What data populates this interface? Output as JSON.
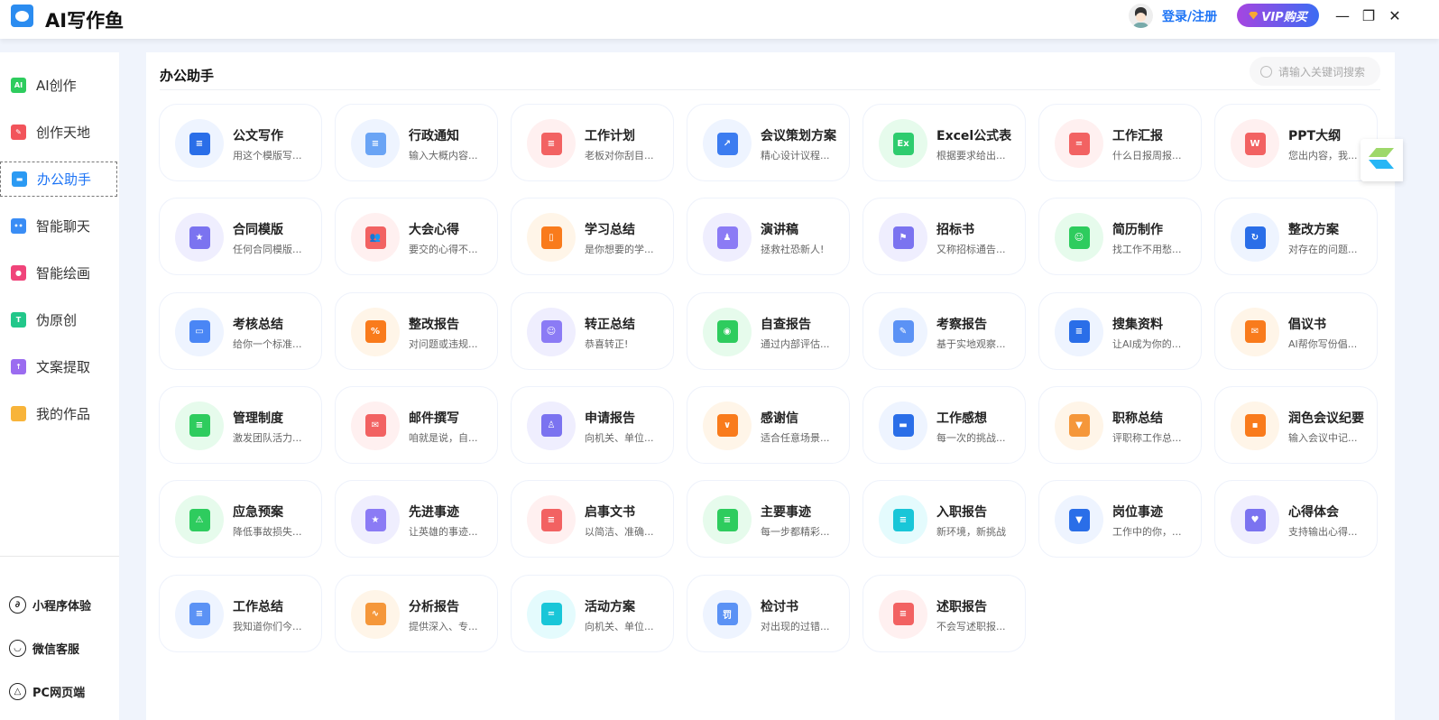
{
  "header": {
    "app_title": "AI写作鱼",
    "login_label": "登录/注册",
    "vip_label": "VIP购买",
    "minimize": "—",
    "maximize": "❐",
    "close": "✕"
  },
  "sidebar": {
    "items": [
      {
        "label": "AI创作",
        "icon": "ai-doc-icon",
        "color": "#2ecc5e",
        "glyph": "AI"
      },
      {
        "label": "创作天地",
        "icon": "pencil-icon",
        "color": "#f2545b",
        "glyph": "✎"
      },
      {
        "label": "办公助手",
        "icon": "briefcase-icon",
        "color": "#2b9af3",
        "glyph": "▬",
        "active": true
      },
      {
        "label": "智能聊天",
        "icon": "chat-icon",
        "color": "#3a8df5",
        "glyph": "••"
      },
      {
        "label": "智能绘画",
        "icon": "palette-icon",
        "color": "#f0447a",
        "glyph": "●"
      },
      {
        "label": "伪原创",
        "icon": "t-doc-icon",
        "color": "#22c78a",
        "glyph": "T"
      },
      {
        "label": "文案提取",
        "icon": "upload-icon",
        "color": "#9b6cf0",
        "glyph": "↑"
      },
      {
        "label": "我的作品",
        "icon": "folder-icon",
        "color": "#f8b43a",
        "glyph": ""
      }
    ],
    "footer": [
      {
        "label": "小程序体验",
        "icon": "mini-program-icon",
        "glyph": "∂"
      },
      {
        "label": "微信客服",
        "icon": "chat-bubble-icon",
        "glyph": "◡"
      },
      {
        "label": "PC网页端",
        "icon": "screen-icon",
        "glyph": "△"
      }
    ]
  },
  "main": {
    "title": "办公助手",
    "search_placeholder": "请输入关键词搜索",
    "cards": [
      {
        "title": "公文写作",
        "desc": "用这个模版写...",
        "color": "#2a6ee8",
        "bg": "#eef4ff",
        "glyph": "≡"
      },
      {
        "title": "行政通知",
        "desc": "输入大概内容...",
        "color": "#6aa4f5",
        "bg": "#eef4ff",
        "glyph": "≡"
      },
      {
        "title": "工作计划",
        "desc": "老板对你刮目...",
        "color": "#f26262",
        "bg": "#fff0f0",
        "glyph": "≡"
      },
      {
        "title": "会议策划方案",
        "desc": "精心设计议程...",
        "color": "#3c7cf0",
        "bg": "#eef4ff",
        "glyph": "↗"
      },
      {
        "title": "Excel公式表",
        "desc": "根据要求给出...",
        "color": "#2ecc6e",
        "bg": "#e6fbec",
        "glyph": "Ex"
      },
      {
        "title": "工作汇报",
        "desc": "什么日报周报...",
        "color": "#f26262",
        "bg": "#fff0f0",
        "glyph": "="
      },
      {
        "title": "PPT大纲",
        "desc": "您出内容，我...",
        "color": "#f26262",
        "bg": "#fff0f0",
        "glyph": "W"
      },
      {
        "title": "合同模版",
        "desc": "任何合同模版...",
        "color": "#7b73f0",
        "bg": "#efeefe",
        "glyph": "★"
      },
      {
        "title": "大会心得",
        "desc": "要交的心得不...",
        "color": "#f26262",
        "bg": "#fff0f0",
        "glyph": "👥"
      },
      {
        "title": "学习总结",
        "desc": "是你想要的学...",
        "color": "#f97b1c",
        "bg": "#fff5e8",
        "glyph": "▯"
      },
      {
        "title": "演讲稿",
        "desc": "拯救社恐新人!",
        "color": "#8b7bf5",
        "bg": "#efeefe",
        "glyph": "♟"
      },
      {
        "title": "招标书",
        "desc": "又称招标通告...",
        "color": "#7b73f0",
        "bg": "#efeefe",
        "glyph": "⚑"
      },
      {
        "title": "简历制作",
        "desc": "找工作不用愁...",
        "color": "#2ecc5e",
        "bg": "#e6fbec",
        "glyph": "☺"
      },
      {
        "title": "整改方案",
        "desc": "对存在的问题...",
        "color": "#2a6ee8",
        "bg": "#eef4ff",
        "glyph": "↻"
      },
      {
        "title": "考核总结",
        "desc": "给你一个标准...",
        "color": "#4a86f5",
        "bg": "#eef4ff",
        "glyph": "▭"
      },
      {
        "title": "整改报告",
        "desc": "对问题或违规...",
        "color": "#f97b1c",
        "bg": "#fff5e8",
        "glyph": "%"
      },
      {
        "title": "转正总结",
        "desc": "恭喜转正!",
        "color": "#8b7bf5",
        "bg": "#efeefe",
        "glyph": "☺"
      },
      {
        "title": "自查报告",
        "desc": "通过内部评估...",
        "color": "#2ecc5e",
        "bg": "#e6fbec",
        "glyph": "◉"
      },
      {
        "title": "考察报告",
        "desc": "基于实地观察...",
        "color": "#5b92f5",
        "bg": "#eef4ff",
        "glyph": "✎"
      },
      {
        "title": "搜集资料",
        "desc": "让AI成为你的...",
        "color": "#2a6ee8",
        "bg": "#eef4ff",
        "glyph": "≡"
      },
      {
        "title": "倡议书",
        "desc": "AI帮你写份倡...",
        "color": "#f97b1c",
        "bg": "#fff5e8",
        "glyph": "✉"
      },
      {
        "title": "管理制度",
        "desc": "激发团队活力...",
        "color": "#2ecc5e",
        "bg": "#e6fbec",
        "glyph": "≡"
      },
      {
        "title": "邮件撰写",
        "desc": "咱就是说，自...",
        "color": "#f26262",
        "bg": "#fff0f0",
        "glyph": "✉"
      },
      {
        "title": "申请报告",
        "desc": "向机关、单位...",
        "color": "#7b73f0",
        "bg": "#efeefe",
        "glyph": "♙"
      },
      {
        "title": "感谢信",
        "desc": "适合任意场景...",
        "color": "#f97b1c",
        "bg": "#fff5e8",
        "glyph": "∨"
      },
      {
        "title": "工作感想",
        "desc": "每一次的挑战...",
        "color": "#2a6ee8",
        "bg": "#eef4ff",
        "glyph": "▬"
      },
      {
        "title": "职称总结",
        "desc": "评职称工作总...",
        "color": "#f5973a",
        "bg": "#fff5e8",
        "glyph": "▼"
      },
      {
        "title": "润色会议纪要",
        "desc": "输入会议中记...",
        "color": "#f97b1c",
        "bg": "#fff5e8",
        "glyph": "▪"
      },
      {
        "title": "应急预案",
        "desc": "降低事故损失...",
        "color": "#2ecc5e",
        "bg": "#e6fbec",
        "glyph": "⚠"
      },
      {
        "title": "先进事迹",
        "desc": "让英雄的事迹...",
        "color": "#8b7bf5",
        "bg": "#efeefe",
        "glyph": "★"
      },
      {
        "title": "启事文书",
        "desc": "以简洁、准确...",
        "color": "#f26262",
        "bg": "#fff0f0",
        "glyph": "≡"
      },
      {
        "title": "主要事迹",
        "desc": "每一步都精彩...",
        "color": "#2ecc5e",
        "bg": "#e6fbec",
        "glyph": "≡"
      },
      {
        "title": "入职报告",
        "desc": "新环境，新挑战",
        "color": "#19c6d8",
        "bg": "#e4fbfd",
        "glyph": "≡"
      },
      {
        "title": "岗位事迹",
        "desc": "工作中的你，...",
        "color": "#2a6ee8",
        "bg": "#eef4ff",
        "glyph": "▼"
      },
      {
        "title": "心得体会",
        "desc": "支持输出心得...",
        "color": "#7b73f0",
        "bg": "#efeefe",
        "glyph": "♥"
      },
      {
        "title": "工作总结",
        "desc": "我知道你们今...",
        "color": "#5b92f5",
        "bg": "#eef4ff",
        "glyph": "≡"
      },
      {
        "title": "分析报告",
        "desc": "提供深入、专...",
        "color": "#f5973a",
        "bg": "#fff5e8",
        "glyph": "∿"
      },
      {
        "title": "活动方案",
        "desc": "向机关、单位...",
        "color": "#19c6d8",
        "bg": "#e4fbfd",
        "glyph": "="
      },
      {
        "title": "检讨书",
        "desc": "对出现的过错...",
        "color": "#5b92f5",
        "bg": "#eef4ff",
        "glyph": "罚"
      },
      {
        "title": "述职报告",
        "desc": "不会写述职报...",
        "color": "#f26262",
        "bg": "#fff0f0",
        "glyph": "≡"
      }
    ]
  }
}
